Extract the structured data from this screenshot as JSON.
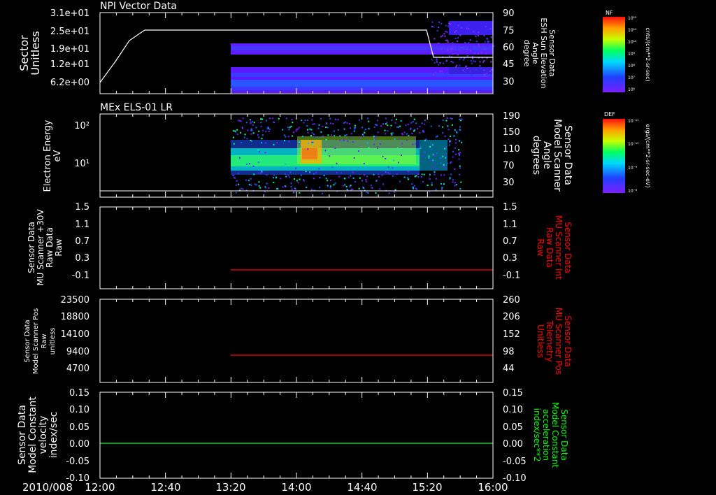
{
  "date_label": "2010/008",
  "time_ticks": [
    "12:00",
    "12:40",
    "13:20",
    "14:00",
    "14:40",
    "15:20",
    "16:00"
  ],
  "colors": {
    "axis": "#ffffff",
    "red_trace": "#ff0000",
    "green_trace": "#00ff00",
    "red_label": "#ff0000",
    "green_label": "#00ff00"
  },
  "chart_data": [
    {
      "type": "heatmap",
      "title": "NPI Vector Data",
      "ylabel_left": [
        "Sector",
        "Unitless"
      ],
      "left_ticks": [
        "3.1e+01",
        "2.5e+01",
        "1.9e+01",
        "1.2e+01",
        "6.2e+00"
      ],
      "ylabel_right": [
        "Sensor Data",
        "ESH Sun Elevation",
        "Angle",
        "degree"
      ],
      "right_ticks": [
        "90",
        "75",
        "60",
        "45",
        "30"
      ],
      "colorbar": {
        "label": "NF",
        "unit": "cnts/(cm**2-sr-sec)",
        "ticks": [
          "10¹²",
          "10¹¹",
          "10¹⁰",
          "10⁹",
          "10⁸",
          "10⁷",
          "10⁶"
        ]
      },
      "overlay_line": {
        "x": [
          "12:00",
          "12:15",
          "12:25",
          "12:30",
          "15:20",
          "15:24",
          "16:00"
        ],
        "y_right_axis": [
          22,
          55,
          77,
          77,
          77,
          49,
          49
        ]
      }
    },
    {
      "type": "heatmap",
      "title": "MEx ELS-01 LR",
      "ylabel_left": [
        "Electron Energy",
        "eV"
      ],
      "left_ticks": [
        "10²",
        "10¹"
      ],
      "ylabel_right": [
        "Sensor Data",
        "Model Scanner",
        "Angle",
        "degrees"
      ],
      "right_ticks": [
        "190",
        "150",
        "110",
        "70",
        "30"
      ],
      "colorbar": {
        "label": "DEF",
        "unit": "ergs/(cm**2-sr-sec-eV)",
        "ticks": [
          "10⁻⁸",
          "10⁻⁹",
          "10⁻¹⁰",
          "10⁻¹¹"
        ]
      },
      "overlay_line": {
        "x": [
          "12:00",
          "16:00"
        ],
        "y_right_axis": [
          17,
          17
        ]
      }
    },
    {
      "type": "line",
      "ylabel_left": [
        "Sensor Data",
        "MU Scanner +30V",
        "Raw Data",
        "Raw"
      ],
      "left_ticks": [
        "1.5",
        "1.1",
        "0.7",
        "0.3",
        "-0.1"
      ],
      "ylabel_right": [
        "Sensor Data",
        "MU Scanner Int",
        "Raw Data",
        "Raw"
      ],
      "right_ticks": [
        "1.5",
        "1.1",
        "0.7",
        "0.3",
        "-0.1"
      ],
      "ylim": [
        -0.5,
        1.5
      ],
      "series": [
        {
          "x": [
            "13:20",
            "16:00"
          ],
          "values": [
            -0.05,
            -0.05
          ]
        }
      ]
    },
    {
      "type": "line",
      "ylabel_left": [
        "Sensor Data",
        "Model Scanner Pos",
        "Raw",
        "unitless"
      ],
      "left_ticks": [
        "23500",
        "18800",
        "14100",
        "9400",
        "4700"
      ],
      "ylabel_right": [
        "Sensor Data",
        "MU Scanner Pos",
        "Telemetry",
        "Unitless"
      ],
      "right_ticks": [
        "260",
        "206",
        "152",
        "98",
        "44"
      ],
      "ylim": [
        0,
        23500
      ],
      "series": [
        {
          "x": [
            "13:20",
            "16:00"
          ],
          "values": [
            8300,
            8300
          ]
        }
      ]
    },
    {
      "type": "line",
      "ylabel_left": [
        "Sensor Data",
        "Model Constant",
        "velocity",
        "index/sec"
      ],
      "left_ticks": [
        "0.15",
        "0.10",
        "0.05",
        "0.00",
        "-0.05",
        "-0.10"
      ],
      "ylabel_right": [
        "Sensor Data",
        "Model Constant",
        "acceleration",
        "index/sec**2"
      ],
      "right_ticks": [
        "0.15",
        "0.10",
        "0.05",
        "0.00",
        "-0.05",
        "-0.10"
      ],
      "ylim": [
        -0.1,
        0.15
      ],
      "series": [
        {
          "x": [
            "12:00",
            "16:00"
          ],
          "values": [
            0.0,
            0.0
          ]
        }
      ]
    }
  ]
}
